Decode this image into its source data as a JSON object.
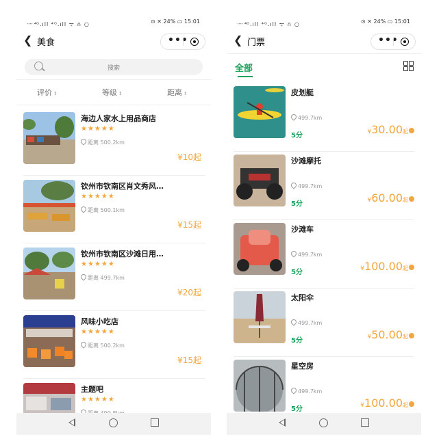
{
  "left": {
    "status": {
      "left_icons": "᠁ ⁴ᴳ.ıll ⁴ᴳ.ıll ᯤ ∩ ○",
      "right_text": "⊙ ✕ 24% ▭ 15:01"
    },
    "title": "美食",
    "search_placeholder": "搜索",
    "sort": {
      "rating": "评价",
      "level": "等级",
      "distance": "距离",
      "arrow": "⇕"
    },
    "shops": [
      {
        "name": "海边人家水上用品商店",
        "stars": "★★★★★",
        "distance": "距离 500.2km",
        "price": "¥10起"
      },
      {
        "name": "钦州市钦南区肖文秀风…",
        "stars": "★★★★★",
        "distance": "距离 500.1km",
        "price": "¥15起"
      },
      {
        "name": "钦州市钦南区沙滩日用…",
        "stars": "★★★★★",
        "distance": "距离 499.7km",
        "price": "¥20起"
      },
      {
        "name": "风味小吃店",
        "stars": "★★★★★",
        "distance": "距离 500.2km",
        "price": "¥15起"
      },
      {
        "name": "主题吧",
        "stars": "★★★★★",
        "distance": "距离 499.8km",
        "price": ""
      }
    ]
  },
  "right": {
    "status": {
      "left_icons": "᠁ ⁴ᴳ.ıll ⁴ᴳ.ıll ᯤ ∩ ○",
      "right_text": "⊙ ✕ 24% ▭ 15:01"
    },
    "title": "门票",
    "tab_all": "全部",
    "tickets": [
      {
        "name": "皮划艇",
        "distance": "499.7km",
        "score": "5分",
        "yen": "¥",
        "price": "30.00",
        "qi": "起"
      },
      {
        "name": "沙滩摩托",
        "distance": "499.7km",
        "score": "5分",
        "yen": "¥",
        "price": "60.00",
        "qi": "起"
      },
      {
        "name": "沙滩车",
        "distance": "499.7km",
        "score": "5分",
        "yen": "¥",
        "price": "100.00",
        "qi": "起"
      },
      {
        "name": "太阳伞",
        "distance": "499.7km",
        "score": "5分",
        "yen": "¥",
        "price": "50.00",
        "qi": "起"
      },
      {
        "name": "星空房",
        "distance": "499.7km",
        "score": "5分",
        "yen": "¥",
        "price": "100.00",
        "qi": "起"
      }
    ]
  },
  "colors": {
    "accent_green": "#1aa35b",
    "price_orange": "#f3a63b"
  }
}
